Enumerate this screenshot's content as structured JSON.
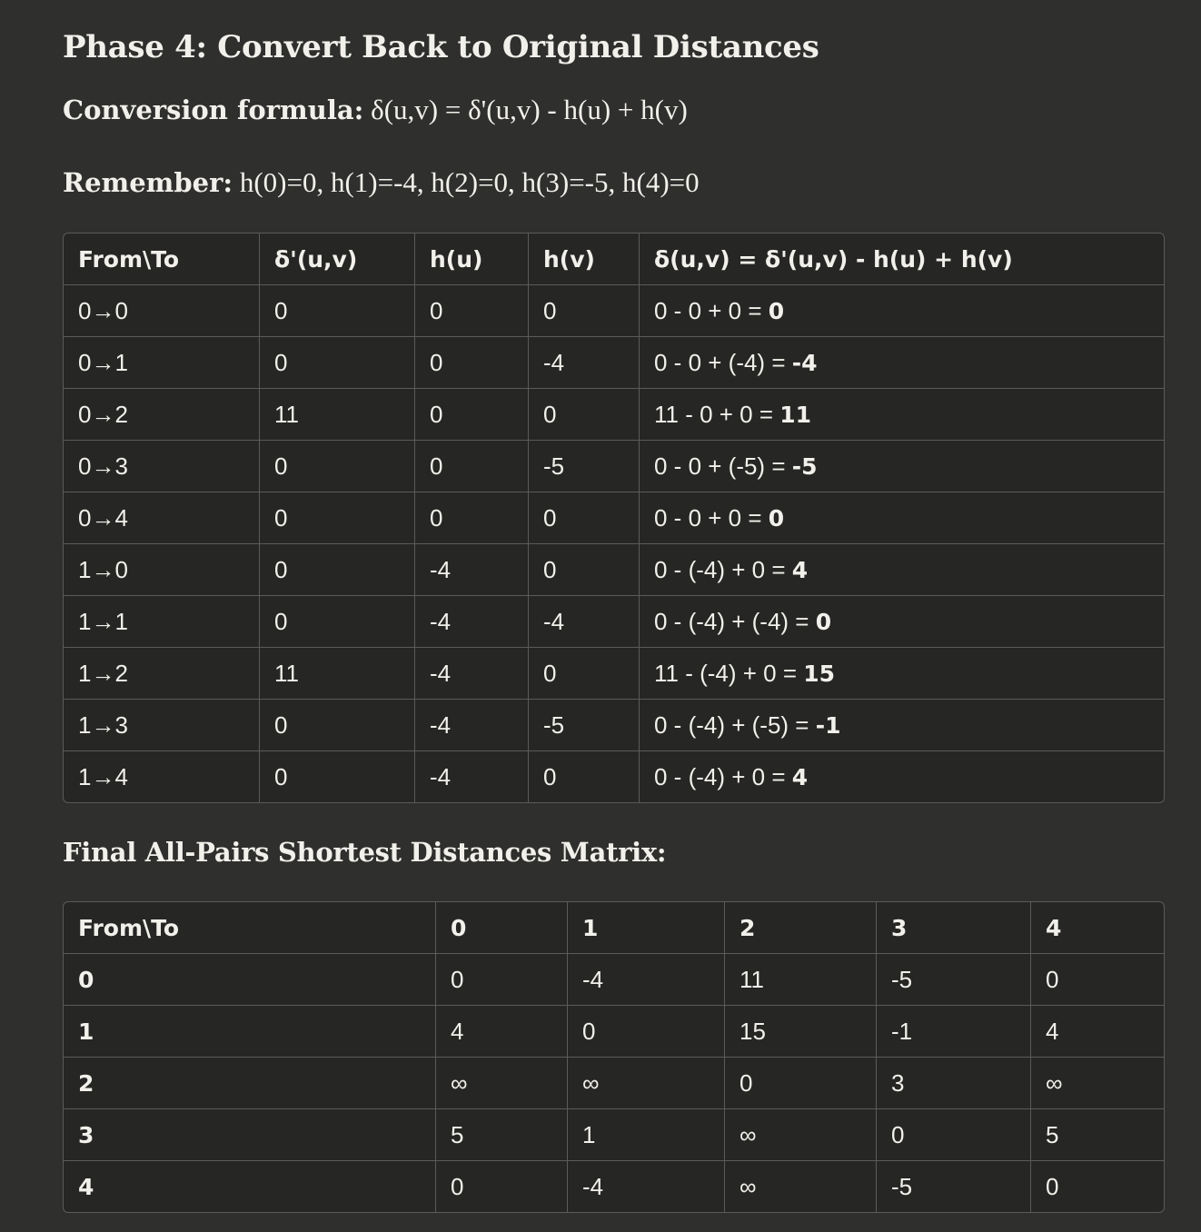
{
  "heading": "Phase 4: Convert Back to Original Distances",
  "formula": {
    "label": "Conversion formula:",
    "text": " δ(u,v) = δ'(u,v) - h(u) + h(v)"
  },
  "remember": {
    "label": "Remember:",
    "text": " h(0)=0, h(1)=-4, h(2)=0, h(3)=-5, h(4)=0"
  },
  "conversion_table": {
    "headers": [
      "From\\To",
      "δ'(u,v)",
      "h(u)",
      "h(v)",
      "δ(u,v) = δ'(u,v) - h(u) + h(v)"
    ],
    "rows": [
      {
        "pair": "0→0",
        "dprime": "0",
        "hu": "0",
        "hv": "0",
        "expr": "0 - 0 + 0 = ",
        "result": "0"
      },
      {
        "pair": "0→1",
        "dprime": "0",
        "hu": "0",
        "hv": "-4",
        "expr": "0 - 0 + (-4) = ",
        "result": "-4"
      },
      {
        "pair": "0→2",
        "dprime": "11",
        "hu": "0",
        "hv": "0",
        "expr": "11 - 0 + 0 = ",
        "result": "11"
      },
      {
        "pair": "0→3",
        "dprime": "0",
        "hu": "0",
        "hv": "-5",
        "expr": "0 - 0 + (-5) = ",
        "result": "-5"
      },
      {
        "pair": "0→4",
        "dprime": "0",
        "hu": "0",
        "hv": "0",
        "expr": "0 - 0 + 0 = ",
        "result": "0"
      },
      {
        "pair": "1→0",
        "dprime": "0",
        "hu": "-4",
        "hv": "0",
        "expr": "0 - (-4) + 0 = ",
        "result": "4"
      },
      {
        "pair": "1→1",
        "dprime": "0",
        "hu": "-4",
        "hv": "-4",
        "expr": "0 - (-4) + (-4) = ",
        "result": "0"
      },
      {
        "pair": "1→2",
        "dprime": "11",
        "hu": "-4",
        "hv": "0",
        "expr": "11 - (-4) + 0 = ",
        "result": "15"
      },
      {
        "pair": "1→3",
        "dprime": "0",
        "hu": "-4",
        "hv": "-5",
        "expr": "0 - (-4) + (-5) = ",
        "result": "-1"
      },
      {
        "pair": "1→4",
        "dprime": "0",
        "hu": "-4",
        "hv": "0",
        "expr": "0 - (-4) + 0 = ",
        "result": "4"
      }
    ]
  },
  "final_heading": "Final All-Pairs Shortest Distances Matrix:",
  "final_matrix": {
    "headers": [
      "From\\To",
      "0",
      "1",
      "2",
      "3",
      "4"
    ],
    "rows": [
      {
        "label": "0",
        "cells": [
          "0",
          "-4",
          "11",
          "-5",
          "0"
        ]
      },
      {
        "label": "1",
        "cells": [
          "4",
          "0",
          "15",
          "-1",
          "4"
        ]
      },
      {
        "label": "2",
        "cells": [
          "∞",
          "∞",
          "0",
          "3",
          "∞"
        ]
      },
      {
        "label": "3",
        "cells": [
          "5",
          "1",
          "∞",
          "0",
          "5"
        ]
      },
      {
        "label": "4",
        "cells": [
          "0",
          "-4",
          "∞",
          "-5",
          "0"
        ]
      }
    ]
  }
}
